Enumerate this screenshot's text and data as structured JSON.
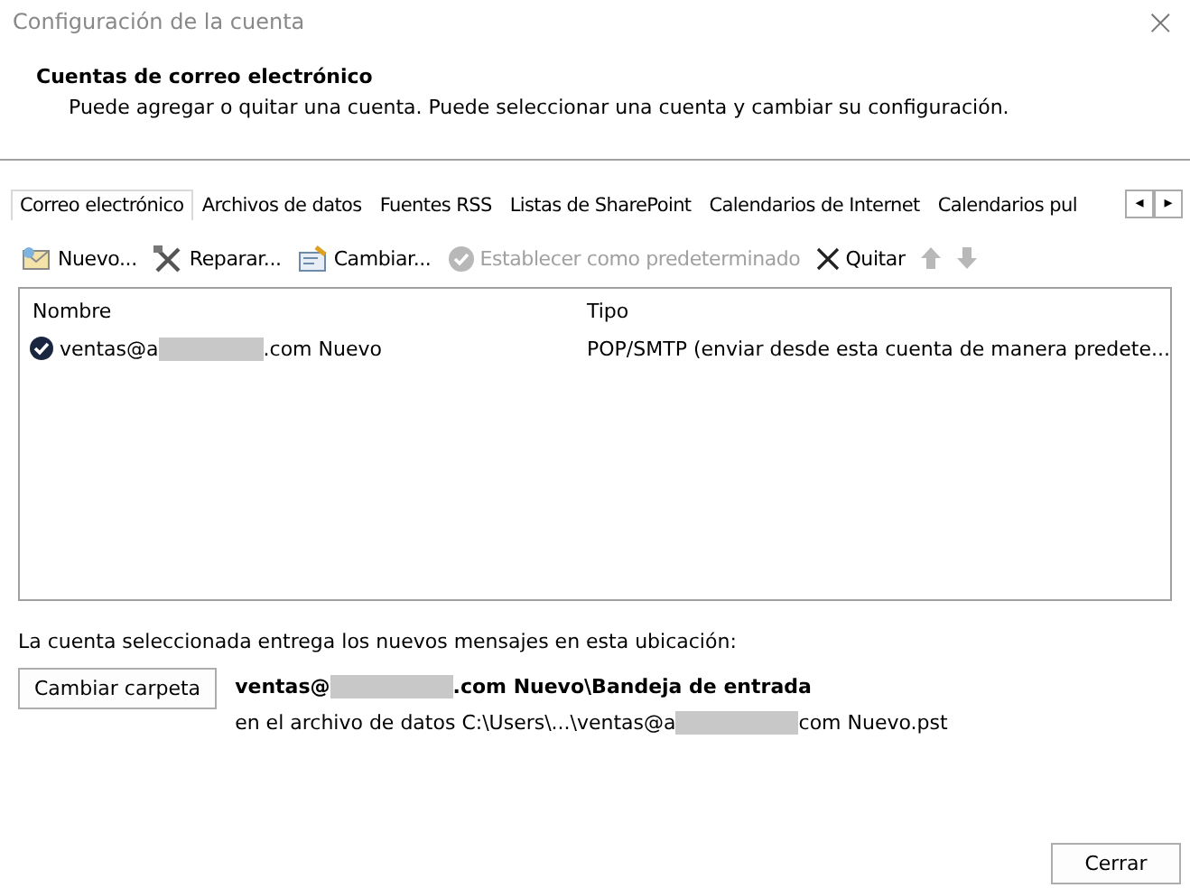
{
  "window": {
    "title": "Configuración de la cuenta",
    "close": "×"
  },
  "header": {
    "title": "Cuentas de correo electrónico",
    "description": "Puede agregar o quitar una cuenta. Puede seleccionar una cuenta y cambiar su configuración."
  },
  "tabs": [
    {
      "label": "Correo electrónico",
      "selected": true
    },
    {
      "label": "Archivos de datos",
      "selected": false
    },
    {
      "label": "Fuentes RSS",
      "selected": false
    },
    {
      "label": "Listas de SharePoint",
      "selected": false
    },
    {
      "label": "Calendarios de Internet",
      "selected": false
    },
    {
      "label": "Calendarios pul",
      "selected": false
    }
  ],
  "tab_scroll": {
    "left": "◂",
    "right": "▸"
  },
  "toolbar": [
    {
      "kind": "new",
      "label": "Nuevo...",
      "disabled": false
    },
    {
      "kind": "repair",
      "label": "Reparar...",
      "disabled": false
    },
    {
      "kind": "change",
      "label": "Cambiar...",
      "disabled": false
    },
    {
      "kind": "default",
      "label": "Establecer como predeterminado",
      "disabled": true
    },
    {
      "kind": "remove",
      "label": "Quitar",
      "disabled": false
    },
    {
      "kind": "up",
      "disabled": true
    },
    {
      "kind": "down",
      "disabled": true
    }
  ],
  "table": {
    "columns": [
      "Nombre",
      "Tipo"
    ],
    "rows": [
      {
        "name_parts": [
          "ventas@a",
          ".com Nuevo"
        ],
        "type": "POP/SMTP (enviar desde esta cuenta de manera predete...",
        "default": true
      }
    ]
  },
  "delivery": {
    "label": "La cuenta seleccionada entrega los nuevos mensajes en esta ubicación:",
    "button": "Cambiar carpeta",
    "folder_parts": [
      "ventas@",
      ".com Nuevo\\Bandeja de entrada"
    ],
    "file_parts": [
      "en el archivo de datos C:\\Users\\...\\ventas@a",
      "com Nuevo.pst"
    ]
  },
  "buttons": [
    "Cerrar"
  ]
}
